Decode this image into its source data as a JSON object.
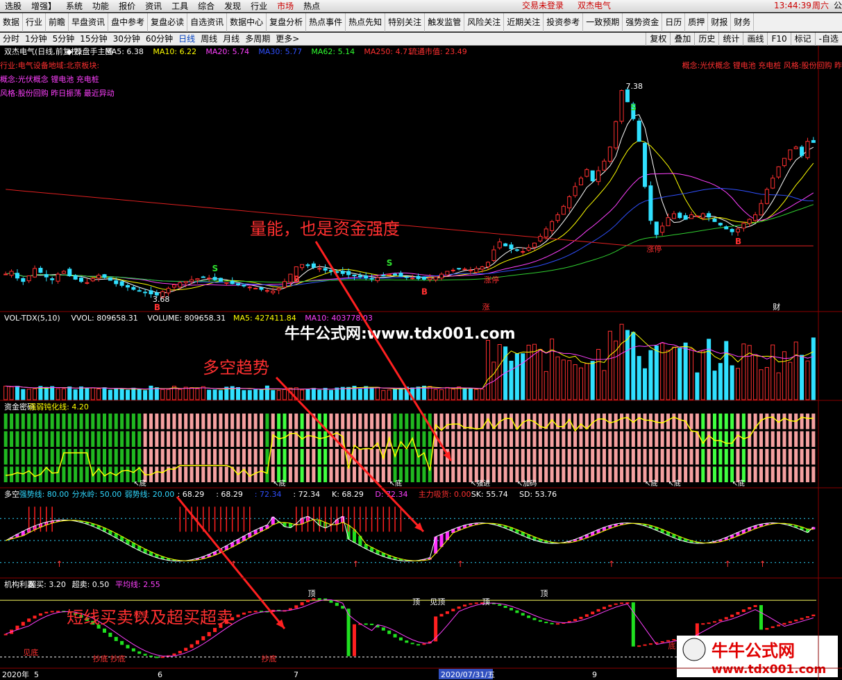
{
  "menu": {
    "items": [
      "选股",
      "增强】",
      "系统",
      "功能",
      "报价",
      "资讯",
      "工具",
      "综合",
      "发现",
      "行业",
      "市场",
      "热点"
    ],
    "active_index": 10,
    "trade_status": "交易未登录",
    "stock_name": "双杰电气",
    "clock": "13:44:39",
    "weekday": "周六",
    "edge_label": "公"
  },
  "toolbar": {
    "items": [
      "数据",
      "行业",
      "前瞻",
      "早盘资讯",
      "盘中参考",
      "复盘必读",
      "自选资讯",
      "数据中心",
      "复盘分析",
      "热点事件",
      "热点先知",
      "特别关注",
      "触发监管",
      "风险关注",
      "近期关注",
      "投资参考",
      "一致预期",
      "强势资金",
      "日历",
      "质押",
      "财报",
      "财务"
    ]
  },
  "periods": {
    "items": [
      "分时",
      "1分钟",
      "5分钟",
      "15分钟",
      "30分钟",
      "60分钟",
      "日线",
      "周线",
      "月线",
      "多周期",
      "更多>"
    ],
    "active_index": 6,
    "right_items": [
      "复权",
      "叠加",
      "历史",
      "统计",
      "画线",
      "F10",
      "标记",
      "-自选"
    ]
  },
  "main_panel": {
    "title": "双杰电气(日线,前复权)",
    "indicator": "操盘手主图",
    "ma_labels": [
      {
        "text": "MA5: 6.38",
        "color": "#ffffff"
      },
      {
        "text": "MA10: 6.22",
        "color": "#ffff00"
      },
      {
        "text": "MA20: 5.74",
        "color": "#ff40ff"
      },
      {
        "text": "MA30: 5.77",
        "color": "#3050ff"
      },
      {
        "text": "MA62: 5.14",
        "color": "#30ff30"
      },
      {
        "text": "MA250: 4.71",
        "color": "#ff3030"
      }
    ],
    "market_value": "流通市值: 23.49",
    "info_industry": "行业:电气设备地域:北京板块:",
    "info_concept": "概念:光伏概念 锂电池 充电桩",
    "info_style": "风格:股份回购 昨日振荡 最近异动",
    "info_right": "概念:光伏概念 锂电池 充电桩 风格:股份回购 昨",
    "high_label": "7.38",
    "low_label": "3.68",
    "zt_label": "涨停",
    "zhang_label": "涨",
    "cai_label": "财"
  },
  "vol_panel": {
    "title": "VOL-TDX(5,10)",
    "labels": [
      {
        "text": "VVOL: 809658.31",
        "color": "#ffffff"
      },
      {
        "text": "VOLUME: 809658.31",
        "color": "#ffffff"
      },
      {
        "text": "MA5: 427411.84",
        "color": "#ffff00"
      },
      {
        "text": "MA10: 403778.03",
        "color": "#ff40ff"
      }
    ]
  },
  "money_panel": {
    "title": "资金密码",
    "labels": [
      {
        "text": "强弱钝化线: 4.20",
        "color": "#ffff00"
      }
    ],
    "markers": [
      "底",
      "底",
      "底",
      "强进",
      "加码",
      "底",
      "底",
      "底"
    ]
  },
  "trend_panel": {
    "title": "多空",
    "labels": [
      {
        "text": "强势线: 80.00",
        "color": "#30d8ff"
      },
      {
        "text": "分水岭: 50.00",
        "color": "#30d8ff"
      },
      {
        "text": "弱势线: 20.00",
        "color": "#30d8ff"
      },
      {
        "text": ": 68.29",
        "color": "#ffffff"
      },
      {
        "text": ": 68.29",
        "color": "#ffffff"
      },
      {
        "text": ": 72.34",
        "color": "#3050ff"
      },
      {
        "text": ": 72.34",
        "color": "#ffffff"
      },
      {
        "text": "K: 68.29",
        "color": "#ffffff"
      },
      {
        "text": "D: 72.34",
        "color": "#ff40ff"
      },
      {
        "text": "主力吸货: 0.00",
        "color": "#ff3030"
      },
      {
        "text": "SK: 55.74",
        "color": "#ffffff"
      },
      {
        "text": "SD: 53.76",
        "color": "#ffffff"
      }
    ]
  },
  "inst_panel": {
    "title": "机构利器",
    "labels": [
      {
        "text": "超买: 3.20",
        "color": "#ffffff"
      },
      {
        "text": "超卖: 0.50",
        "color": "#ffffff"
      },
      {
        "text": "平均线: 2.55",
        "color": "#ff40ff"
      }
    ],
    "markers": [
      "见底",
      "极底",
      "抄底",
      "抄底",
      "抄底",
      "顶",
      "顶",
      "见顶",
      "顶",
      "顶",
      "底",
      "极底"
    ]
  },
  "date_axis": {
    "labels": [
      "2020年",
      "5",
      "6",
      "7",
      "2020/07/31/五",
      "9"
    ]
  },
  "annotations": [
    {
      "text": "量能，也是资金强度"
    },
    {
      "text": "多空趋势"
    },
    {
      "text": "短线买卖以及超买超卖"
    }
  ],
  "watermark": "牛牛公式网:www.tdx001.com",
  "logo_text": "牛牛公式网",
  "logo_url": "www.tdx001.com",
  "chart_data": {
    "type": "candlestick",
    "title": "双杰电气(日线,前复权)",
    "price_high_marked": 7.38,
    "price_low_marked": 3.68,
    "price_axis_range": [
      3.4,
      7.6
    ],
    "closes": [
      4.05,
      4.1,
      3.98,
      3.92,
      4.02,
      4.15,
      4.08,
      4.0,
      3.95,
      4.05,
      4.1,
      4.02,
      3.96,
      3.92,
      3.9,
      3.97,
      4.03,
      3.99,
      3.94,
      3.88,
      3.85,
      3.82,
      3.78,
      3.75,
      3.72,
      3.7,
      3.68,
      3.74,
      3.8,
      3.86,
      3.9,
      3.92,
      3.95,
      3.97,
      4.0,
      3.98,
      3.95,
      3.92,
      3.9,
      3.88,
      3.86,
      3.84,
      3.82,
      3.8,
      3.78,
      3.76,
      3.75,
      3.8,
      3.92,
      4.05,
      4.18,
      4.22,
      4.2,
      4.17,
      4.15,
      4.12,
      4.1,
      4.08,
      4.06,
      4.04,
      4.02,
      4.0,
      3.98,
      3.97,
      3.99,
      4.02,
      4.05,
      4.03,
      4.01,
      4.0,
      3.98,
      3.97,
      3.96,
      3.98,
      4.0,
      4.05,
      4.1,
      4.12,
      4.15,
      4.14,
      4.12,
      4.15,
      4.18,
      4.26,
      4.48,
      4.62,
      4.55,
      4.5,
      4.47,
      4.45,
      4.52,
      4.6,
      4.72,
      4.85,
      4.98,
      5.1,
      5.25,
      5.42,
      5.6,
      5.75,
      5.9,
      5.7,
      5.88,
      6.05,
      6.3,
      6.75,
      7.3,
      7.1,
      6.8,
      6.4,
      5.6,
      5.0,
      4.75,
      4.9,
      5.05,
      5.12,
      5.05,
      5.02,
      5.1,
      5.08,
      5.12,
      5.06,
      4.98,
      4.92,
      4.85,
      4.8,
      4.85,
      4.95,
      5.02,
      5.1,
      5.3,
      5.55,
      5.75,
      5.95,
      6.1,
      6.25,
      6.3,
      6.15,
      6.4,
      6.38
    ],
    "volume_range": [
      0,
      1000000
    ],
    "volume_last": 809658.31,
    "ma": {
      "MA5": 6.38,
      "MA10": 6.22,
      "MA20": 5.74,
      "MA30": 5.77,
      "MA62": 5.14,
      "MA250": 4.71
    },
    "money_strength_range": [
      0,
      4.5
    ],
    "money_strength_last": 4.2,
    "trend_range": [
      0,
      100
    ],
    "trend_levels": {
      "strong": 80,
      "water": 50,
      "weak": 20
    },
    "trend_k_last": 68.29,
    "trend_d_last": 72.34,
    "inst_range": [
      0,
      3.5
    ],
    "inst_levels": {
      "overbought": 3.2,
      "oversold": 0.5
    },
    "inst_avg_last": 2.55
  }
}
